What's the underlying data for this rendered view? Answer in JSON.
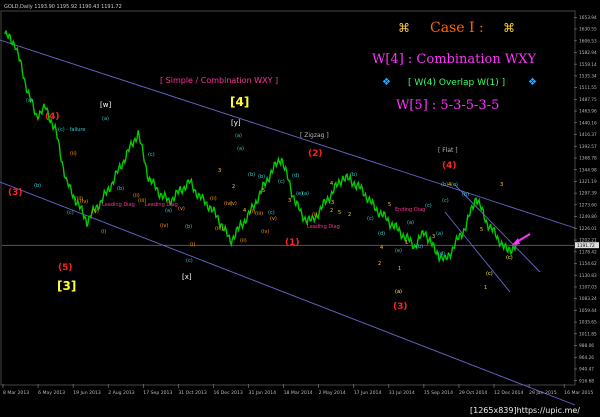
{
  "header": {
    "info_text": "GOLD,Daily  1193.90 1195.92 1190.43 1191.72"
  },
  "case_panel": {
    "line1_left_symbol": "⌘",
    "line1_title": "Case I :",
    "line1_right_symbol": "⌘",
    "line2": "W[4] : Combination WXY",
    "line3_left_symbol": "❖",
    "line3": "[ W(4) Overlap W(1) ]",
    "line3_right_symbol": "❖",
    "line4": "W[5] : 5-3-5-3-5"
  },
  "footer": {
    "watermark": "[1265x839]https://upic.me/"
  },
  "colors": {
    "background": "#000000",
    "price": "#00cc00",
    "channel": "#6666cc",
    "red_label": "#ff2222",
    "cyan_label": "#33cccc",
    "yellow_label": "#ffff33",
    "magenta_label": "#ff33ff",
    "orange_label": "#ff9900",
    "pink_label": "#ff3399",
    "gold_label": "#ffcc33"
  },
  "chart_data": {
    "type": "line",
    "title": "",
    "xlabel": "",
    "ylabel": "",
    "x_ticks": [
      "8 Mar 2013",
      "6 May 2013",
      "19 Jun 2013",
      "2 Aug 2013",
      "17 Sep 2013",
      "31 Oct 2013",
      "16 Dec 2013",
      "31 Jan 2014",
      "18 Mar 2014",
      "2 May 2014",
      "17 Jun 2014",
      "31 Jul 2014",
      "15 Sep 2014",
      "29 Oct 2014",
      "12 Dec 2014",
      "29 Jan 2015",
      "16 Mar 2015"
    ],
    "y_ticks": [
      "1653.94",
      "1630.55",
      "1606.53",
      "1582.94",
      "1559.14",
      "1535.34",
      "1511.55",
      "1487.75",
      "1463.96",
      "1440.16",
      "1416.37",
      "1392.57",
      "1368.78",
      "1344.98",
      "1321.19",
      "1297.39",
      "1273.60",
      "1249.80",
      "1226.01",
      "1202.21",
      "1178.42",
      "1154.62",
      "1130.83",
      "1107.03",
      "1083.24",
      "1059.44",
      "1035.65",
      "1011.85",
      "988.06",
      "964.26",
      "940.47",
      "916.68"
    ],
    "ylim": [
      910,
      1665
    ],
    "current_price": "1191.72",
    "series": [
      {
        "name": "",
        "x_index": [
          0,
          2,
          4,
          6,
          8,
          10,
          12,
          14,
          16,
          18,
          20,
          22,
          24,
          26,
          28,
          30,
          32,
          34,
          36,
          38,
          40,
          42,
          44,
          46,
          48,
          50,
          52,
          54,
          56,
          58,
          60,
          62,
          64,
          66,
          68,
          70,
          72,
          74,
          76,
          78,
          80,
          82,
          84,
          86,
          88,
          90,
          92,
          94,
          96,
          98,
          100
        ],
        "values": [
          1620,
          1600,
          1520,
          1455,
          1470,
          1420,
          1320,
          1280,
          1240,
          1270,
          1300,
          1340,
          1380,
          1420,
          1330,
          1300,
          1280,
          1300,
          1320,
          1290,
          1270,
          1240,
          1200,
          1230,
          1260,
          1300,
          1340,
          1370,
          1300,
          1250,
          1240,
          1270,
          1300,
          1330,
          1320,
          1300,
          1270,
          1250,
          1230,
          1210,
          1190,
          1220,
          1180,
          1160,
          1195,
          1230,
          1290,
          1240,
          1210,
          1180,
          1191.72
        ]
      }
    ],
    "annotations": [
      {
        "text": "[ Simple / Combination WXY ]",
        "color": "pink"
      },
      {
        "text": "[ Zigzag ]",
        "color": "gray"
      },
      {
        "text": "[ Flat ]",
        "color": "gray"
      },
      {
        "text": "[4]",
        "color": "yellow"
      },
      {
        "text": "[3]",
        "color": "yellow"
      },
      {
        "text": "[w]",
        "color": "white"
      },
      {
        "text": "[x]",
        "color": "white"
      },
      {
        "text": "[y]",
        "color": "white"
      },
      {
        "text": "(4)",
        "color": "red"
      },
      {
        "text": "(3)",
        "color": "red"
      },
      {
        "text": "(5)",
        "color": "red"
      },
      {
        "text": "(2)",
        "color": "red"
      },
      {
        "text": "(1)",
        "color": "red"
      },
      {
        "text": "(3)",
        "color": "red"
      },
      {
        "text": "(4)",
        "color": "red"
      },
      {
        "text": "(c) - failure",
        "color": "cyan"
      },
      {
        "text": "Leading Diag",
        "color": "pink"
      },
      {
        "text": "Leading Diag",
        "color": "pink"
      },
      {
        "text": "Leading Diag",
        "color": "pink"
      },
      {
        "text": "Ending Diag",
        "color": "pink"
      },
      {
        "text": "(a)",
        "color": "cyan"
      },
      {
        "text": "(b)",
        "color": "cyan"
      },
      {
        "text": "(c)",
        "color": "cyan"
      },
      {
        "text": "(a)",
        "color": "cyan"
      },
      {
        "text": "(b)",
        "color": "cyan"
      },
      {
        "text": "(c)",
        "color": "cyan"
      },
      {
        "text": "(a)",
        "color": "cyan"
      },
      {
        "text": "(b)",
        "color": "cyan"
      },
      {
        "text": "(c)",
        "color": "cyan"
      },
      {
        "text": "(a)",
        "color": "cyan"
      },
      {
        "text": "(b)",
        "color": "cyan"
      },
      {
        "text": "(c)",
        "color": "cyan"
      },
      {
        "text": "(a)",
        "color": "cyan"
      },
      {
        "text": "(b)",
        "color": "cyan"
      },
      {
        "text": "(c)",
        "color": "cyan"
      },
      {
        "text": "(e)",
        "color": "cyan"
      },
      {
        "text": "(d)",
        "color": "cyan"
      },
      {
        "text": "(a)",
        "color": "cyan"
      },
      {
        "text": "(b)",
        "color": "cyan"
      },
      {
        "text": "(c)",
        "color": "cyan"
      },
      {
        "text": "(d)",
        "color": "cyan"
      },
      {
        "text": "(e)",
        "color": "cyan"
      },
      {
        "text": "(a)",
        "color": "cyan"
      },
      {
        "text": "(b)",
        "color": "cyan"
      },
      {
        "text": "(c)",
        "color": "cyan"
      },
      {
        "text": "(a)",
        "color": "cyan"
      },
      {
        "text": "(b)",
        "color": "cyan"
      },
      {
        "text": "(d)",
        "color": "cyan"
      },
      {
        "text": "(c)",
        "color": "cyan"
      },
      {
        "text": "(e)",
        "color": "cyan"
      },
      {
        "text": "(b)",
        "color": "cyan"
      },
      {
        "text": "(c)",
        "color": "yellow"
      },
      {
        "text": "(a)",
        "color": "yellow"
      },
      {
        "text": "(c)",
        "color": "yellow"
      },
      {
        "text": "1",
        "color": "gold"
      },
      {
        "text": "2",
        "color": "gold"
      },
      {
        "text": "3",
        "color": "gold"
      },
      {
        "text": "4",
        "color": "gold"
      },
      {
        "text": "5",
        "color": "gold"
      },
      {
        "text": "3",
        "color": "gold"
      },
      {
        "text": "4",
        "color": "gold"
      },
      {
        "text": "5",
        "color": "gold"
      },
      {
        "text": "2",
        "color": "gold"
      },
      {
        "text": "1",
        "color": "gold"
      },
      {
        "text": "3",
        "color": "gold"
      },
      {
        "text": "4",
        "color": "gold"
      },
      {
        "text": "5",
        "color": "gold"
      },
      {
        "text": "2",
        "color": "gold"
      },
      {
        "text": "4",
        "color": "gold"
      },
      {
        "text": "3",
        "color": "gold"
      },
      {
        "text": "5",
        "color": "gold"
      },
      {
        "text": "1",
        "color": "gold"
      },
      {
        "text": "2",
        "color": "gold"
      },
      {
        "text": "3",
        "color": "gold"
      },
      {
        "text": "(i)",
        "color": "orange"
      },
      {
        "text": "(ii)",
        "color": "orange"
      },
      {
        "text": "(iii)",
        "color": "orange"
      },
      {
        "text": "(iv)",
        "color": "orange"
      },
      {
        "text": "(v)",
        "color": "orange"
      },
      {
        "text": "(i)",
        "color": "orange"
      },
      {
        "text": "(ii)",
        "color": "orange"
      },
      {
        "text": "(iii)",
        "color": "orange"
      },
      {
        "text": "(iv)",
        "color": "orange"
      },
      {
        "text": "(v)",
        "color": "orange"
      },
      {
        "text": "(i)",
        "color": "orange"
      },
      {
        "text": "(ii)",
        "color": "orange"
      },
      {
        "text": "(iii)",
        "color": "orange"
      },
      {
        "text": "(iv)",
        "color": "orange"
      },
      {
        "text": "(v)",
        "color": "orange"
      },
      {
        "text": "(i)",
        "color": "orange"
      },
      {
        "text": "(ii)",
        "color": "orange"
      },
      {
        "text": "(iii)",
        "color": "orange"
      },
      {
        "text": "(iv)",
        "color": "orange"
      },
      {
        "text": "(v)",
        "color": "orange"
      }
    ]
  }
}
